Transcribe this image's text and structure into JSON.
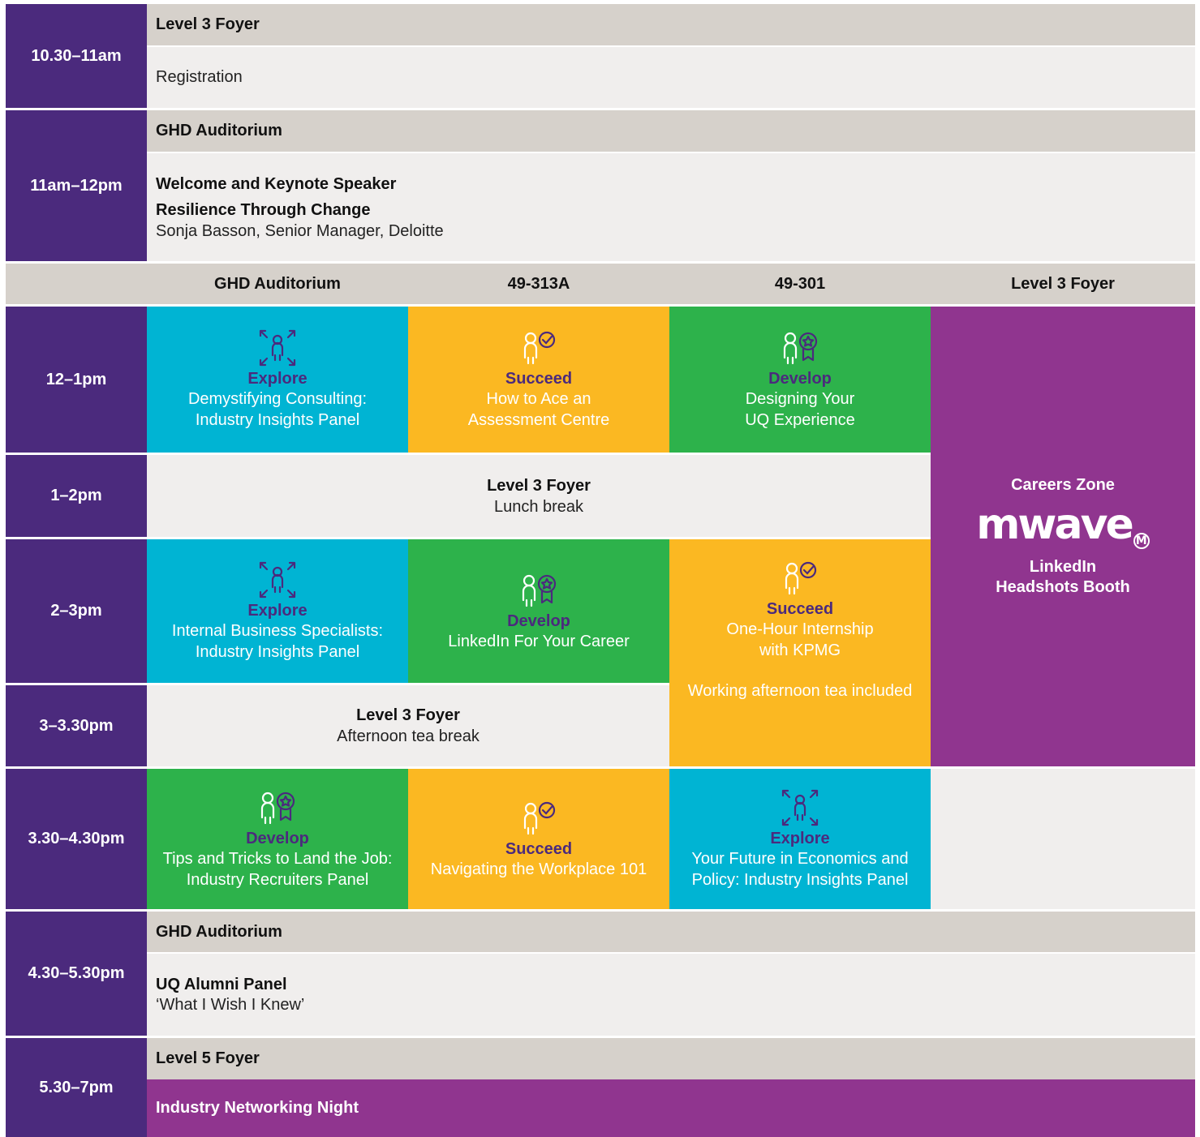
{
  "rows": [
    {
      "time": "10.30–11am",
      "venue": "Level 3 Foyer",
      "lines": [
        "Registration"
      ]
    },
    {
      "time": "11am–12pm",
      "venue": "GHD Auditorium",
      "title": "Welcome and Keynote Speaker",
      "subtitle": "Resilience Through Change",
      "detail": "Sonja Basson, Senior Manager, Deloitte"
    }
  ],
  "columns": [
    "GHD Auditorium",
    "49-313A",
    "49-301",
    "Level 3 Foyer"
  ],
  "times": {
    "t12": "12–1pm",
    "t1": "1–2pm",
    "t2": "2–3pm",
    "t3": "3–3.30pm",
    "t330": "3.30–4.30pm",
    "t430": "4.30–5.30pm",
    "t530": "5.30–7pm"
  },
  "sessions": {
    "s12a": {
      "cat": "Explore",
      "l1": "Demystifying Consulting:",
      "l2": "Industry Insights Panel",
      "icon": "explore-icon"
    },
    "s12b": {
      "cat": "Succeed",
      "l1": "How to Ace an",
      "l2": "Assessment Centre",
      "icon": "succeed-icon"
    },
    "s12c": {
      "cat": "Develop",
      "l1": "Designing Your",
      "l2": "UQ Experience",
      "icon": "develop-icon"
    },
    "s2a": {
      "cat": "Explore",
      "l1": "Internal Business Specialists:",
      "l2": "Industry Insights Panel",
      "icon": "explore-icon"
    },
    "s2b": {
      "cat": "Develop",
      "l1": "LinkedIn For Your Career",
      "icon": "develop-icon"
    },
    "s2c": {
      "cat": "Succeed",
      "l1": "One-Hour Internship",
      "l2": "with KPMG",
      "l3": "Working afternoon tea included",
      "icon": "succeed-icon"
    },
    "s330a": {
      "cat": "Develop",
      "l1": "Tips and Tricks to Land the Job:",
      "l2": "Industry Recruiters Panel",
      "icon": "develop-icon"
    },
    "s330b": {
      "cat": "Succeed",
      "l1": "Navigating the Workplace 101",
      "icon": "succeed-icon"
    },
    "s330c": {
      "cat": "Explore",
      "l1": "Your Future in Economics and",
      "l2": "Policy: Industry Insights Panel",
      "icon": "explore-icon"
    }
  },
  "lunch": {
    "venue": "Level 3 Foyer",
    "label": "Lunch break"
  },
  "tea": {
    "venue": "Level 3 Foyer",
    "label": "Afternoon tea break"
  },
  "careers": {
    "title": "Careers Zone",
    "logo": "mwave",
    "logo_mark": "M",
    "l1": "LinkedIn",
    "l2": "Headshots Booth"
  },
  "alumni": {
    "venue": "GHD Auditorium",
    "title": "UQ Alumni Panel",
    "subtitle": "‘What I Wish I Knew’"
  },
  "networking": {
    "venue": "Level 5 Foyer",
    "title": "Industry Networking Night"
  },
  "colors": {
    "time": "#4b2a7d",
    "venue": "#d6d1cb",
    "body": "#f0eeed",
    "explore": "#00b4d3",
    "succeed": "#fbb822",
    "develop": "#2db24b",
    "zone": "#90358f"
  }
}
